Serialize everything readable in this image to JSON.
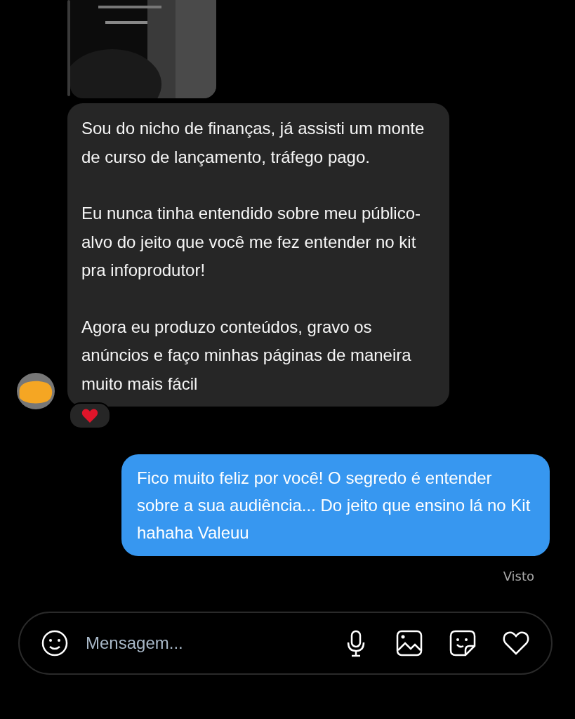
{
  "received_message": {
    "paragraphs": [
      "Sou do nicho de finanças, já assisti um monte de curso de lançamento, tráfego pago.",
      "Eu nunca tinha entendido sobre meu público-alvo do jeito que você me fez entender no kit pra infoprodutor!",
      "Agora eu produzo conteúdos, gravo os anúncios e faço minhas páginas de maneira muito mais fácil"
    ],
    "heart_reaction": true
  },
  "sent_message": {
    "text": "Fico muito feliz por você! O segredo é entender sobre a sua audiência... Do jeito que ensino lá no Kit hahaha Valeuu",
    "status": "Visto"
  },
  "composer": {
    "placeholder": "Mensagem..."
  }
}
